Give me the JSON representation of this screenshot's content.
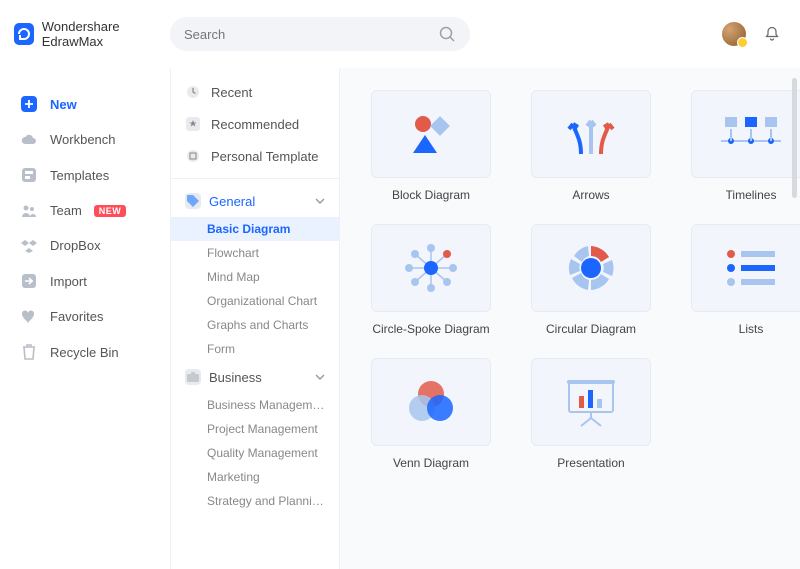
{
  "brand": {
    "name": "Wondershare EdrawMax"
  },
  "search": {
    "placeholder": "Search"
  },
  "sidebar": {
    "items": [
      {
        "label": "New"
      },
      {
        "label": "Workbench"
      },
      {
        "label": "Templates"
      },
      {
        "label": "Team",
        "badge": "NEW"
      },
      {
        "label": "DropBox"
      },
      {
        "label": "Import"
      },
      {
        "label": "Favorites"
      },
      {
        "label": "Recycle Bin"
      }
    ]
  },
  "midbar": {
    "top": [
      {
        "label": "Recent"
      },
      {
        "label": "Recommended"
      },
      {
        "label": "Personal Template"
      }
    ],
    "categories": [
      {
        "label": "General",
        "expanded": true,
        "active": true,
        "subs": [
          {
            "label": "Basic Diagram",
            "active": true
          },
          {
            "label": "Flowchart"
          },
          {
            "label": "Mind Map"
          },
          {
            "label": "Organizational Chart"
          },
          {
            "label": "Graphs and Charts"
          },
          {
            "label": "Form"
          }
        ]
      },
      {
        "label": "Business",
        "expanded": true,
        "subs": [
          {
            "label": "Business Management"
          },
          {
            "label": "Project Management"
          },
          {
            "label": "Quality Management"
          },
          {
            "label": "Marketing"
          },
          {
            "label": "Strategy and Planning"
          }
        ]
      }
    ]
  },
  "templates": [
    {
      "label": "Block Diagram"
    },
    {
      "label": "Arrows"
    },
    {
      "label": "Timelines"
    },
    {
      "label": "Circle-Spoke Diagram"
    },
    {
      "label": "Circular Diagram"
    },
    {
      "label": "Lists"
    },
    {
      "label": "Venn Diagram"
    },
    {
      "label": "Presentation"
    }
  ]
}
